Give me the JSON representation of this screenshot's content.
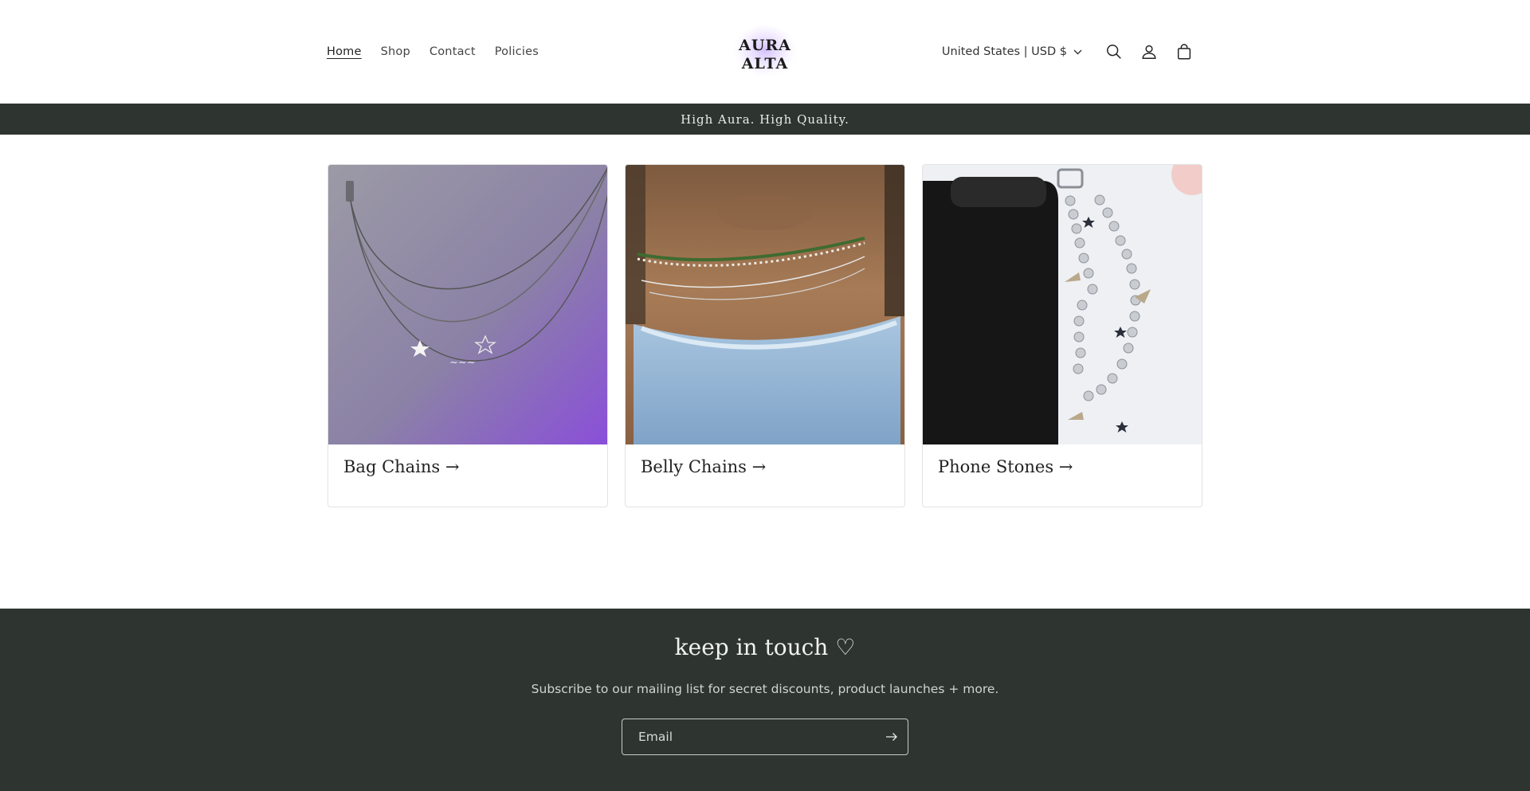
{
  "brand": {
    "logo_text_line1": "AURA",
    "logo_text_line2": "ALTA"
  },
  "nav": {
    "items": [
      {
        "label": "Home",
        "active": true
      },
      {
        "label": "Shop",
        "active": false
      },
      {
        "label": "Contact",
        "active": false
      },
      {
        "label": "Policies",
        "active": false
      }
    ]
  },
  "header": {
    "locale_label": "United States | USD $",
    "icons": [
      "search-icon",
      "account-icon",
      "cart-icon"
    ]
  },
  "announcement": {
    "text": "High Aura. High Quality."
  },
  "collections": [
    {
      "title": "Bag Chains →",
      "image": "bag-chains-image"
    },
    {
      "title": "Belly Chains →",
      "image": "belly-chains-image"
    },
    {
      "title": "Phone Stones →",
      "image": "phone-stones-image"
    }
  ],
  "newsletter": {
    "title": "keep in touch ♡",
    "subtitle": "Subscribe to our mailing list for secret discounts, product launches + more.",
    "email_placeholder": "Email"
  },
  "colors": {
    "dark_band": "#2e3530",
    "footer_text": "#e9ece9"
  }
}
